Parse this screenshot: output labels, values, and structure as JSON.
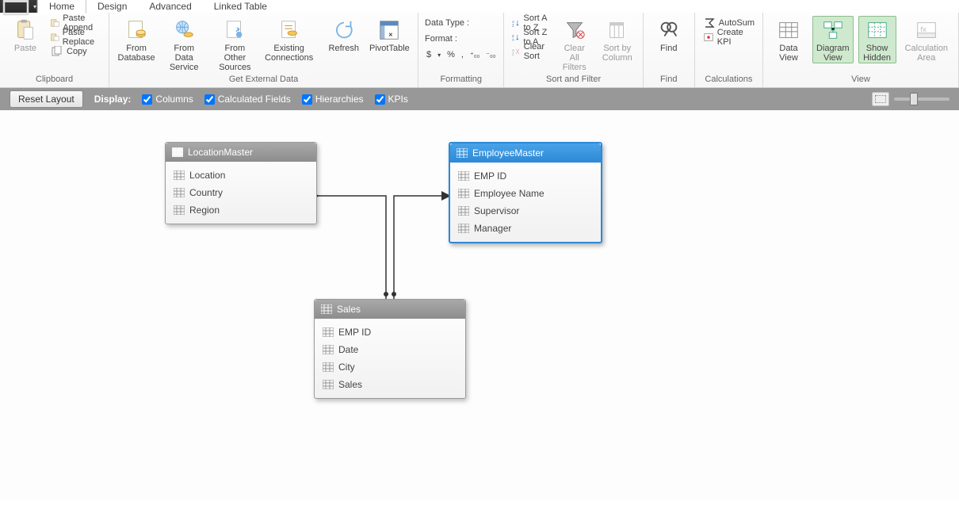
{
  "tabs": {
    "home": "Home",
    "design": "Design",
    "advanced": "Advanced",
    "linked": "Linked Table"
  },
  "ribbon": {
    "clipboard": {
      "label": "Clipboard",
      "paste": "Paste",
      "pasteAppend": "Paste Append",
      "pasteReplace": "Paste Replace",
      "copy": "Copy"
    },
    "getdata": {
      "label": "Get External Data",
      "fromDb": "From\nDatabase",
      "fromSvc": "From Data\nService",
      "fromOther": "From Other\nSources",
      "existing": "Existing\nConnections",
      "refresh": "Refresh",
      "pivot": "PivotTable"
    },
    "formatting": {
      "label": "Formatting",
      "dataType": "Data Type :",
      "format": "Format :",
      "dollar": "$",
      "pct": "%",
      "comma": ",",
      "inc": ".00",
      "dec": ".00"
    },
    "sort": {
      "label": "Sort and Filter",
      "az": "Sort A to Z",
      "za": "Sort Z to A",
      "clearSort": "Clear Sort",
      "clearFilters": "Clear All\nFilters",
      "sortCol": "Sort by\nColumn"
    },
    "find": {
      "label": "Find",
      "find": "Find"
    },
    "calc": {
      "label": "Calculations",
      "autosum": "AutoSum",
      "kpi": "Create KPI"
    },
    "view": {
      "label": "View",
      "dataView": "Data\nView",
      "diagramView": "Diagram\nView",
      "showHidden": "Show\nHidden",
      "calcArea": "Calculation\nArea"
    }
  },
  "displaybar": {
    "reset": "Reset Layout",
    "display": "Display:",
    "columns": "Columns",
    "calcFields": "Calculated Fields",
    "hier": "Hierarchies",
    "kpis": "KPIs"
  },
  "tables": {
    "location": {
      "title": "LocationMaster",
      "cols": [
        "Location",
        "Country",
        "Region"
      ]
    },
    "employee": {
      "title": "EmployeeMaster",
      "cols": [
        "EMP ID",
        "Employee Name",
        "Supervisor",
        "Manager"
      ]
    },
    "sales": {
      "title": "Sales",
      "cols": [
        "EMP ID",
        "Date",
        "City",
        "Sales"
      ]
    }
  }
}
